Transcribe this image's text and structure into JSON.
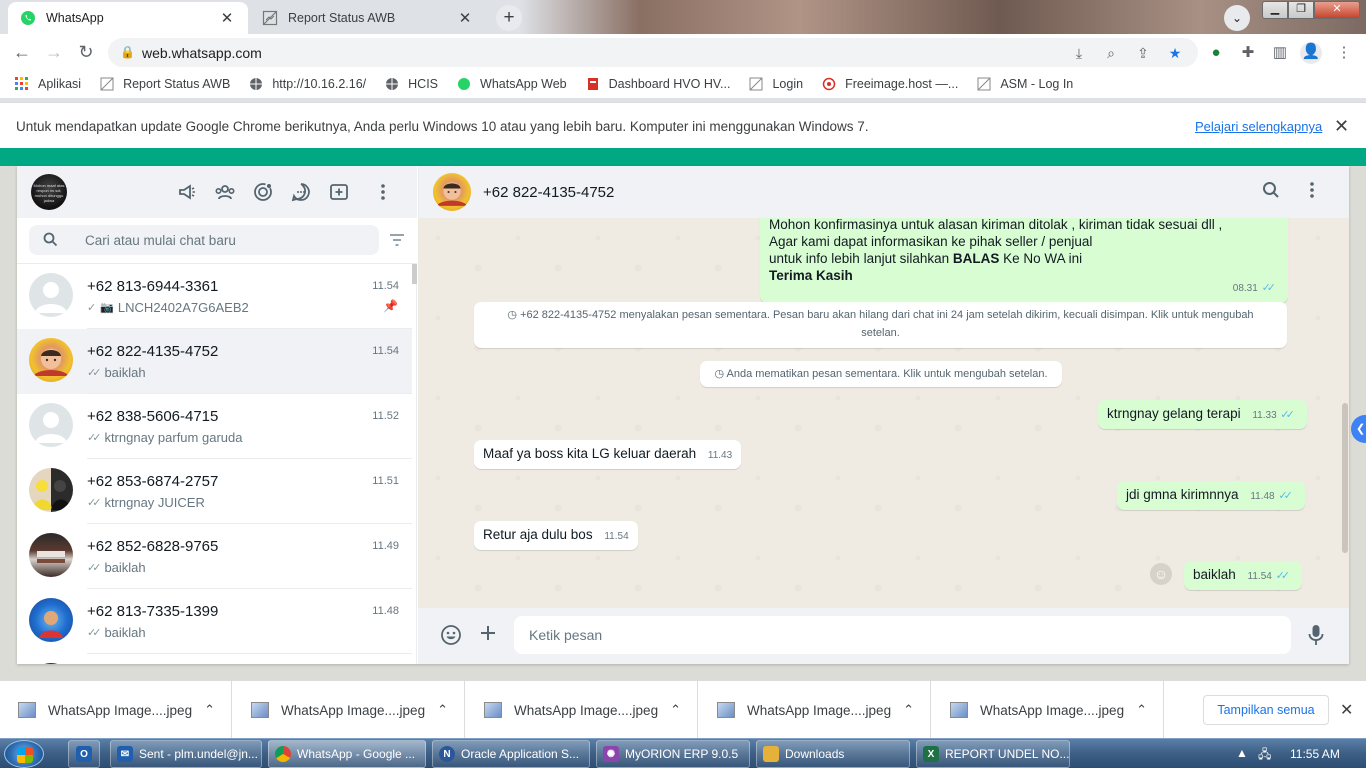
{
  "browser": {
    "tabs": [
      {
        "label": "WhatsApp",
        "icon": "whatsapp-icon"
      },
      {
        "label": "Report Status AWB",
        "icon": "broken-image-icon"
      }
    ],
    "url": "web.whatsapp.com",
    "bookmarks": [
      {
        "label": "Aplikasi",
        "icon": "apps-grid-icon"
      },
      {
        "label": "Report Status AWB",
        "icon": "broken-image-icon"
      },
      {
        "label": "http://10.16.2.16/",
        "icon": "globe-icon"
      },
      {
        "label": "HCIS",
        "icon": "globe-icon"
      },
      {
        "label": "WhatsApp Web",
        "icon": "whatsapp-icon"
      },
      {
        "label": "Dashboard HVO HV...",
        "icon": "dashboard-icon"
      },
      {
        "label": "Login",
        "icon": "broken-image-icon"
      },
      {
        "label": "Freeimage.host —...",
        "icon": "freeimage-icon"
      },
      {
        "label": "ASM - Log In",
        "icon": "broken-image-icon"
      }
    ],
    "infobar": {
      "message": "Untuk mendapatkan update Google Chrome berikutnya, Anda perlu Windows 10 atau yang lebih baru. Komputer ini menggunakan Windows 7.",
      "link": "Pelajari selengkapnya"
    }
  },
  "whatsapp": {
    "my_avatar_text": "Mohon maaf atas respon ns sdi, mohon ditunggu jadwa",
    "search_placeholder": "Cari atau mulai chat baru",
    "chats": [
      {
        "name": "+62 813-6944-3361",
        "time": "11.54",
        "preview": "LNCH2402A7G6AEB2",
        "ticks": "single",
        "photo": true,
        "pinned": true,
        "avatar": "default"
      },
      {
        "name": "+62 822-4135-4752",
        "time": "11.54",
        "preview": "baiklah",
        "ticks": "double",
        "selected": true,
        "avatar": "baby"
      },
      {
        "name": "+62 838-5606-4715",
        "time": "11.52",
        "preview": "ktrngnay parfum garuda",
        "ticks": "double",
        "avatar": "default"
      },
      {
        "name": "+62 853-6874-2757",
        "time": "11.51",
        "preview": "ktrngnay JUICER",
        "ticks": "double",
        "avatar": "couple"
      },
      {
        "name": "+62 852-6828-9765",
        "time": "11.49",
        "preview": "baiklah",
        "ticks": "double",
        "avatar": "room"
      },
      {
        "name": "+62 813-7335-1399",
        "time": "11.48",
        "preview": "baiklah",
        "ticks": "double",
        "avatar": "blue"
      }
    ],
    "conversation": {
      "title": "+62 822-4135-4752",
      "first_message": {
        "line1": "Mohon konfirmasinya untuk alasan kiriman ditolak , kiriman tidak sesuai dll ,",
        "line2": "Agar kami dapat informasikan ke pihak seller / penjual",
        "line3_pre": "untuk info lebih lanjut silahkan ",
        "line3_bold": "BALAS",
        "line3_post": " Ke No WA ini",
        "line4": "Terima Kasih",
        "time": "08.31"
      },
      "system_1": "+62 822-4135-4752 menyalakan pesan sementara. Pesan baru akan hilang dari chat ini 24 jam setelah dikirim, kecuali disimpan. Klik untuk mengubah setelan.",
      "system_2": "Anda mematikan pesan sementara. Klik untuk mengubah setelan.",
      "messages": [
        {
          "dir": "out",
          "text": "ktrngnay gelang terapi",
          "time": "11.33"
        },
        {
          "dir": "in",
          "text": "Maaf ya boss kita LG keluar daerah",
          "time": "11.43"
        },
        {
          "dir": "out",
          "text": "jdi gmna kirimnnya",
          "time": "11.48"
        },
        {
          "dir": "in",
          "text": "Retur aja dulu bos",
          "time": "11.54"
        },
        {
          "dir": "out",
          "text": "baiklah",
          "time": "11.54"
        }
      ],
      "input_placeholder": "Ketik pesan"
    }
  },
  "downloads": {
    "items": [
      "WhatsApp Image....jpeg",
      "WhatsApp Image....jpeg",
      "WhatsApp Image....jpeg",
      "WhatsApp Image....jpeg",
      "WhatsApp Image....jpeg"
    ],
    "show_all": "Tampilkan semua"
  },
  "taskbar": {
    "items": [
      {
        "label": "Sent - plm.undel@jn...",
        "icon": "outlook-icon",
        "color": "#1f5fae"
      },
      {
        "label": "WhatsApp - Google ...",
        "icon": "chrome-icon",
        "color": "#db4437"
      },
      {
        "label": "Oracle Application S...",
        "icon": "oracle-icon",
        "color": "#2b579a"
      },
      {
        "label": "MyORION ERP 9.0.5",
        "icon": "orion-icon",
        "color": "#8e44ad"
      },
      {
        "label": "Downloads",
        "icon": "folder-icon",
        "color": "#e5b13a"
      },
      {
        "label": "REPORT UNDEL NO...",
        "icon": "excel-icon",
        "color": "#1e7145"
      }
    ],
    "clock": "11:55 AM"
  },
  "colors": {
    "wa_green": "#00a884",
    "out_bubble": "#d9fdd3",
    "read_tick": "#53bdeb",
    "chrome_blue": "#1a73e8"
  }
}
